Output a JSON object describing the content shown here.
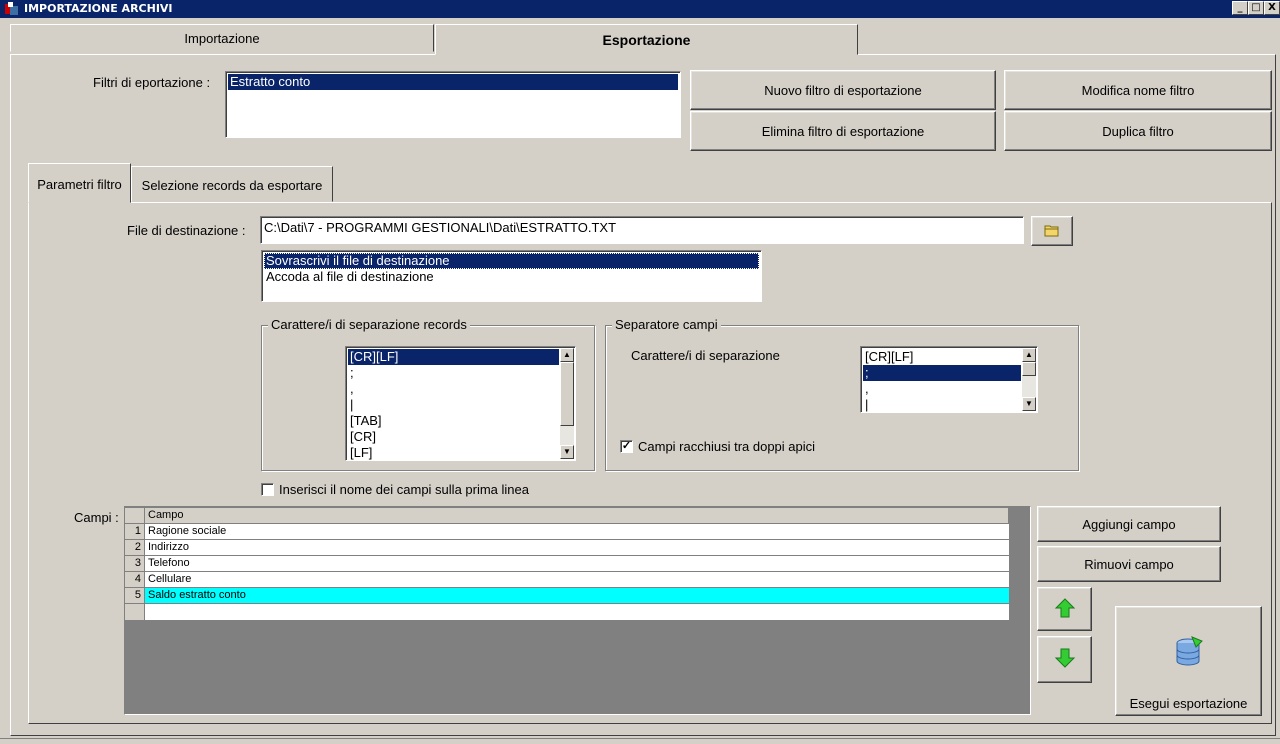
{
  "window": {
    "title": "IMPORTAZIONE ARCHIVI",
    "controls": [
      "_",
      "□",
      "X"
    ]
  },
  "tabs": [
    {
      "label": "Importazione",
      "active": false
    },
    {
      "label": "Esportazione",
      "active": true
    }
  ],
  "filters": {
    "label": "Filtri di eportazione :",
    "items": [
      "Estratto conto"
    ],
    "selected": 0,
    "buttons": {
      "new": "Nuovo filtro di esportazione",
      "rename": "Modifica nome filtro",
      "delete": "Elimina filtro di esportazione",
      "duplicate": "Duplica filtro"
    }
  },
  "subtabs": [
    {
      "label": "Parametri filtro",
      "active": true
    },
    {
      "label": "Selezione records da esportare",
      "active": false
    }
  ],
  "destination": {
    "label": "File di destinazione :",
    "path": "C:\\Dati\\7 - PROGRAMMI GESTIONALI\\Dati\\ESTRATTO.TXT",
    "browse_icon": "folder-icon",
    "modes": [
      "Sovrascrivi il file di destinazione",
      "Accoda al file di destinazione"
    ],
    "selected_mode": 0
  },
  "record_separator": {
    "legend": "Carattere/i di separazione records",
    "items": [
      "[CR][LF]",
      ";",
      ",",
      "|",
      "[TAB]",
      "[CR]",
      "[LF]"
    ],
    "selected": 0
  },
  "field_separator": {
    "legend": "Separatore campi",
    "label": "Carattere/i di separazione",
    "items": [
      "[CR][LF]",
      ";",
      ",",
      "|"
    ],
    "selected": 1,
    "quotes_label": "Campi racchiusi tra doppi apici",
    "quotes_checked": true
  },
  "header_line": {
    "label": "Inserisci il nome dei campi sulla prima linea",
    "checked": false
  },
  "fields": {
    "label": "Campi :",
    "column_header": "Campo",
    "rows": [
      {
        "n": "1",
        "name": "Ragione sociale"
      },
      {
        "n": "2",
        "name": "Indirizzo"
      },
      {
        "n": "3",
        "name": "Telefono"
      },
      {
        "n": "4",
        "name": "Cellulare"
      },
      {
        "n": "5",
        "name": "Saldo estratto conto"
      }
    ],
    "highlighted_row": 4,
    "highlight_color": "#00ffff",
    "add_label": "Aggiungi campo",
    "remove_label": "Rimuovi campo",
    "up_icon": "arrow-up-icon",
    "down_icon": "arrow-down-icon",
    "arrow_color": "#33cc33"
  },
  "run": {
    "label": "Esegui esportazione",
    "icon": "database-export-icon"
  }
}
